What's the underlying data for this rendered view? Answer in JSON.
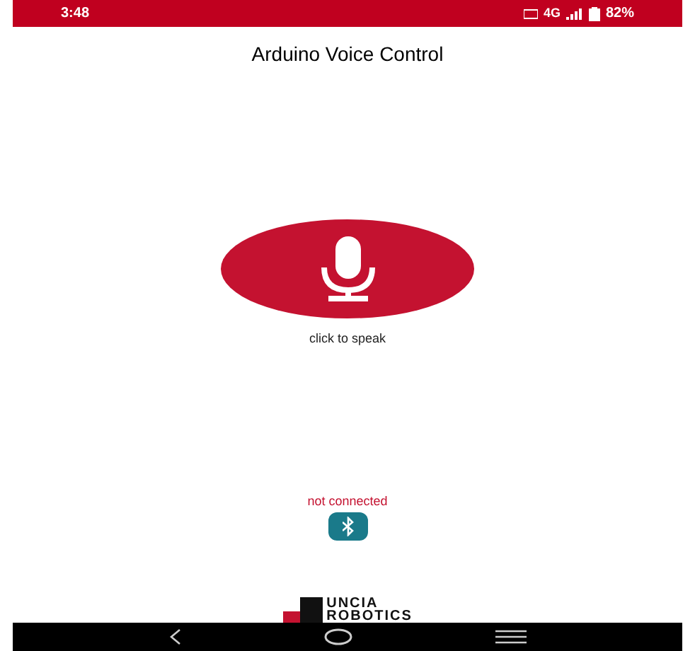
{
  "status_bar": {
    "time": "3:48",
    "network": "4G",
    "battery": "82%"
  },
  "title": "Arduino Voice Control",
  "speak_hint": "click to speak",
  "connection": {
    "status": "not connected",
    "connected": false
  },
  "logo": {
    "line_1": "UNCIA",
    "line_2": "ROBOTICS"
  }
}
